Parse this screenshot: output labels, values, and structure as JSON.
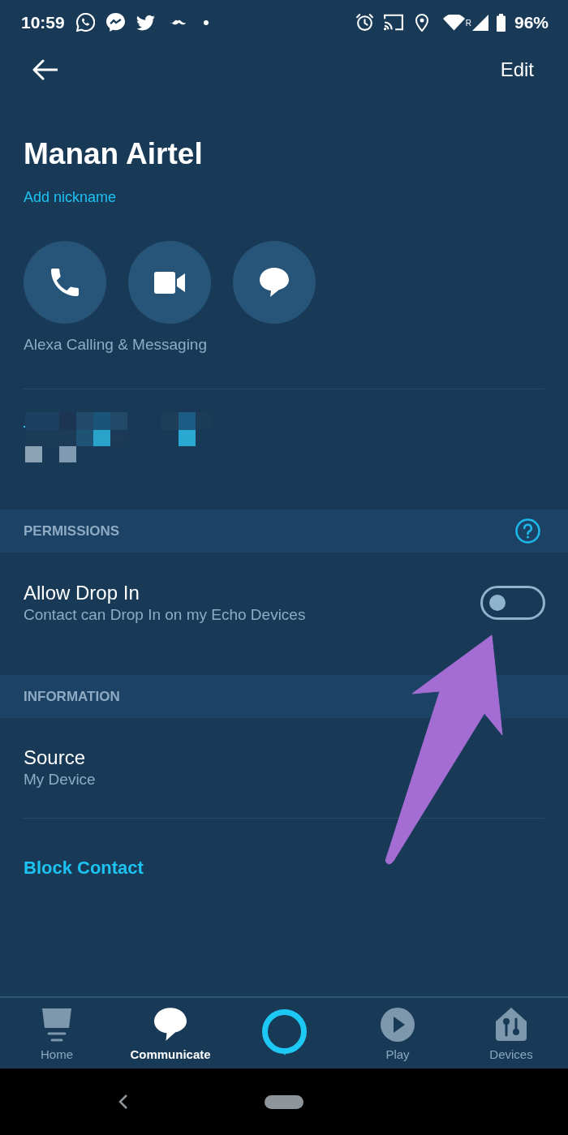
{
  "status_bar": {
    "time": "10:59",
    "roaming_mark": "R",
    "battery": "96%"
  },
  "top_bar": {
    "edit_label": "Edit"
  },
  "contact": {
    "name": "Manan Airtel",
    "nickname_link": "Add nickname",
    "pixelated_detail": true
  },
  "actions": [
    {
      "kind": "call"
    },
    {
      "kind": "video"
    },
    {
      "kind": "message"
    }
  ],
  "actions_caption": "Alexa Calling & Messaging",
  "sections": [
    {
      "header": "PERMISSIONS",
      "help": true,
      "rows": [
        {
          "kind": "toggle",
          "title": "Allow Drop In",
          "subtitle": "Contact can Drop In on my Echo Devices",
          "on": false
        }
      ]
    },
    {
      "header": "INFORMATION",
      "help": false,
      "rows": [
        {
          "kind": "info",
          "title": "Source",
          "subtitle": "My Device"
        }
      ]
    }
  ],
  "block_link": "Block Contact",
  "bottom_nav": [
    {
      "kind": "home",
      "label": "Home",
      "selected": false
    },
    {
      "kind": "communicate",
      "label": "Communicate",
      "selected": true
    },
    {
      "kind": "alexa",
      "selected": false
    },
    {
      "kind": "play",
      "label": "Play",
      "selected": false
    },
    {
      "kind": "devices",
      "label": "Devices",
      "selected": false
    }
  ],
  "annotations": [
    {
      "kind": "arrow"
    }
  ]
}
